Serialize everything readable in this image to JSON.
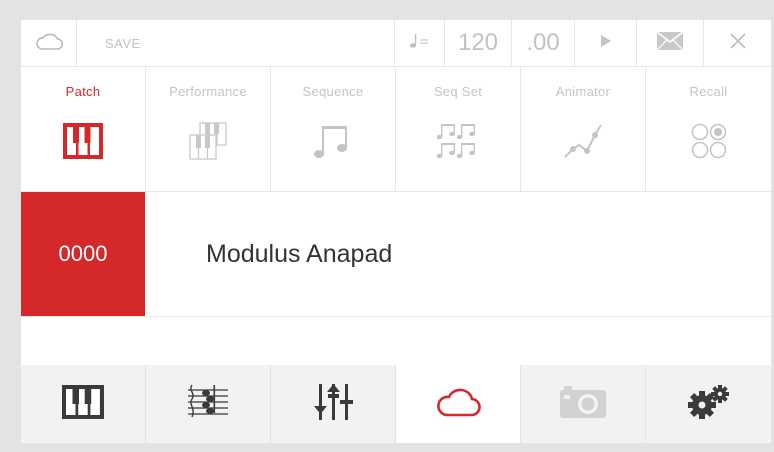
{
  "toolbar": {
    "cloud_icon": "cloud-icon",
    "save_label": "SAVE",
    "tempo_icon": "quarter-note-icon",
    "tempo_integer": "120",
    "tempo_decimal": ".00",
    "play_icon": "play-icon",
    "mail_icon": "envelope-icon",
    "close_icon": "close-icon"
  },
  "tabs": [
    {
      "label": "Patch",
      "icon": "keyboard-icon",
      "active": true
    },
    {
      "label": "Performance",
      "icon": "stacked-keyboards-icon",
      "active": false
    },
    {
      "label": "Sequence",
      "icon": "music-notes-icon",
      "active": false
    },
    {
      "label": "Seq Set",
      "icon": "music-notes-grid-icon",
      "active": false
    },
    {
      "label": "Animator",
      "icon": "automation-curve-icon",
      "active": false
    },
    {
      "label": "Recall",
      "icon": "recall-circles-icon",
      "active": false
    }
  ],
  "patch": {
    "number": "0000",
    "name": "Modulus Anapad"
  },
  "bottom_nav": [
    {
      "icon": "keyboard-icon",
      "active": false
    },
    {
      "icon": "score-staff-icon",
      "active": false
    },
    {
      "icon": "mixer-sliders-icon",
      "active": false
    },
    {
      "icon": "cloud-icon",
      "active": true
    },
    {
      "icon": "camera-icon",
      "active": false
    },
    {
      "icon": "gears-icon",
      "active": false
    }
  ],
  "colors": {
    "accent": "#d4282b",
    "inactive": "#c2c2c2",
    "dark_icon": "#3a3a3a",
    "background": "#e3e3e3"
  }
}
